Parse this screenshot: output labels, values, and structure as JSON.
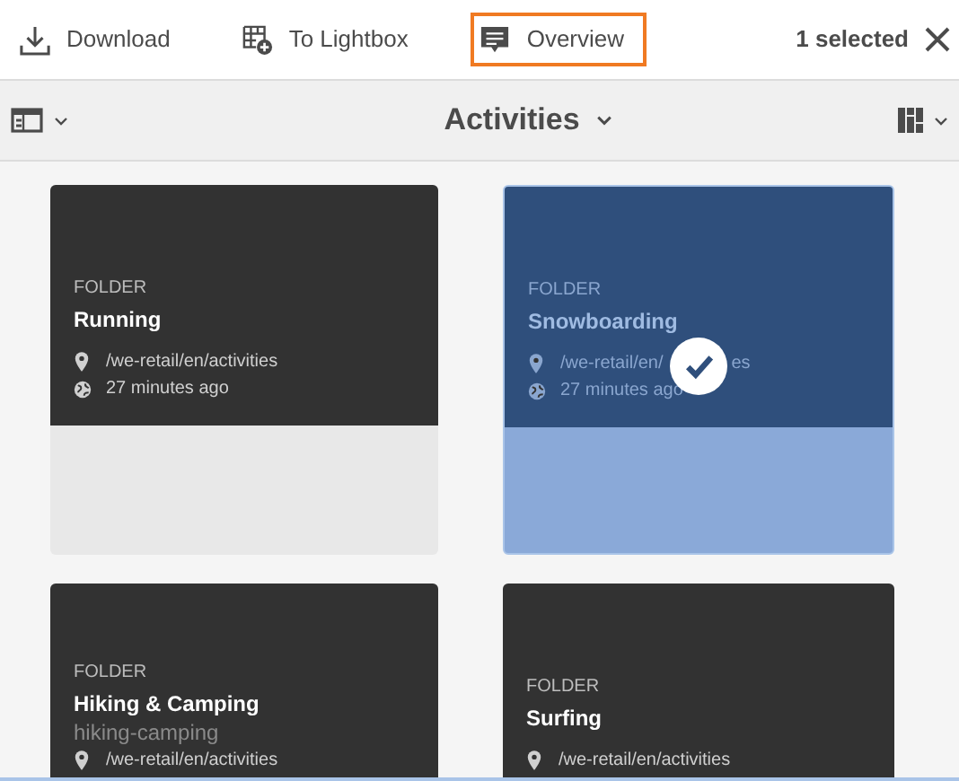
{
  "toolbar": {
    "actions": [
      {
        "label": "Download",
        "kind": "download",
        "focused": false
      },
      {
        "label": "To Lightbox",
        "kind": "lightbox",
        "focused": false
      },
      {
        "label": "Overview",
        "kind": "overview",
        "focused": true
      }
    ],
    "selection": "1 selected"
  },
  "header": {
    "title": "Activities"
  },
  "cards": [
    {
      "type": "FOLDER",
      "title": "Running",
      "path": "/we-retail/en/activities",
      "time": "27 minutes ago",
      "selected": false
    },
    {
      "type": "FOLDER",
      "title": "Snowboarding",
      "path": "/we-retail/en/",
      "path_after_check": "es",
      "time": "27 minutes ago",
      "selected": true
    },
    {
      "type": "FOLDER",
      "title": "Hiking & Camping",
      "name": "hiking-camping",
      "path": "/we-retail/en/activities",
      "selected": false
    },
    {
      "type": "FOLDER",
      "title": "Surfing",
      "path": "/we-retail/en/activities",
      "selected": false
    }
  ]
}
